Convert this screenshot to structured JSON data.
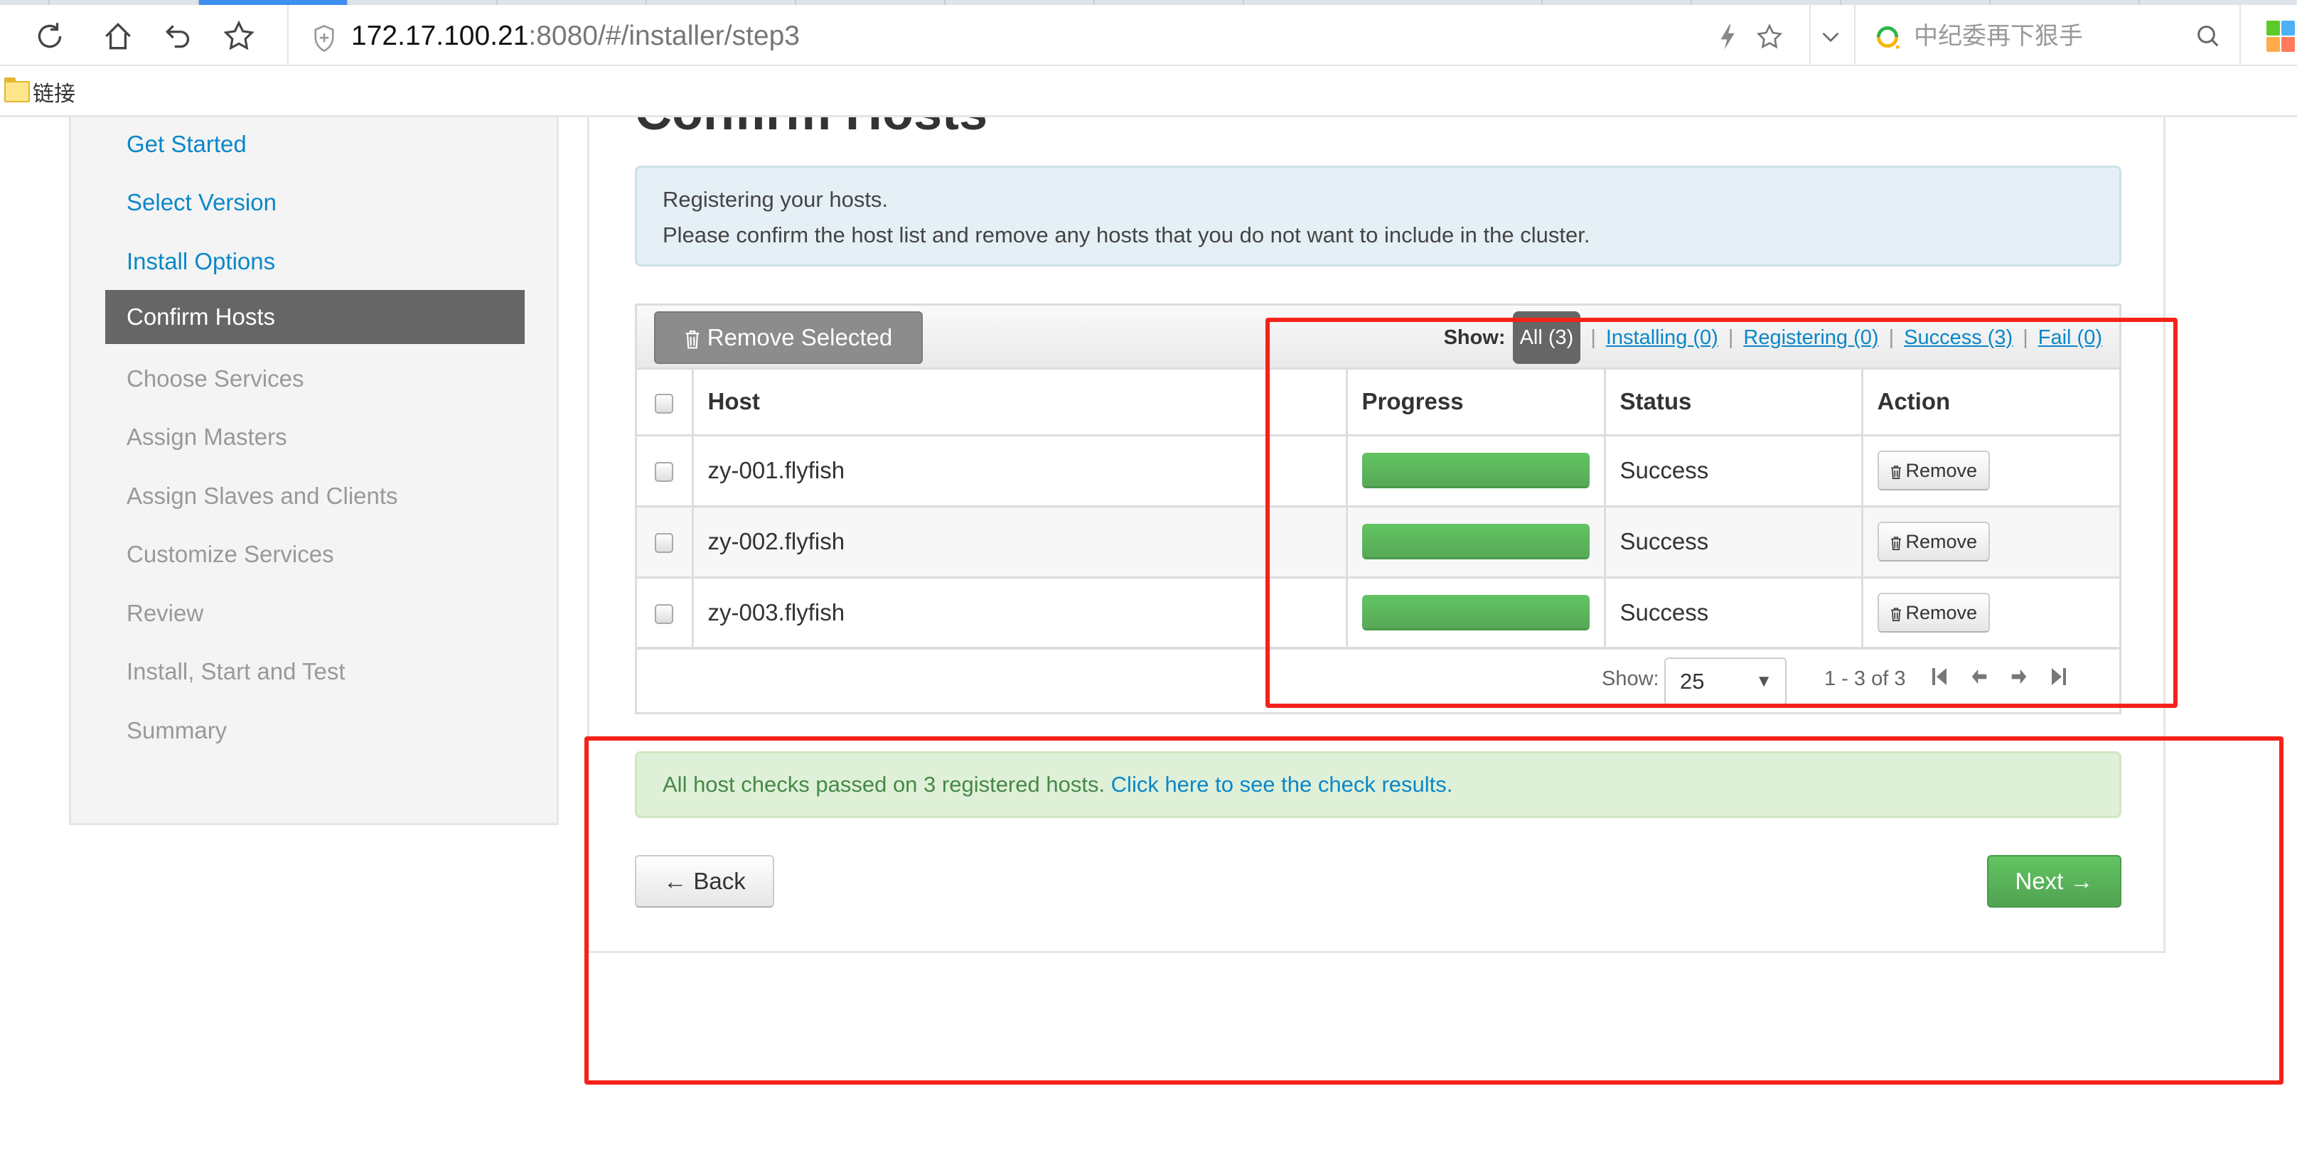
{
  "browser": {
    "address_host": "172.17.100.21",
    "address_rest": ":8080/#/installer/step3",
    "search_placeholder": "中纪委再下狠手",
    "bookmark_folder": "链接",
    "icons": [
      "reload-icon",
      "home-icon",
      "undo-icon",
      "favorite-star-icon",
      "shield-icon",
      "lightning-icon",
      "star-icon",
      "chevron-down-icon",
      "search-logo-icon",
      "search-icon",
      "apps-icon"
    ]
  },
  "sidebar": {
    "items": [
      {
        "label": "Get Started",
        "state": "done"
      },
      {
        "label": "Select Version",
        "state": "done"
      },
      {
        "label": "Install Options",
        "state": "done"
      },
      {
        "label": "Confirm Hosts",
        "state": "active"
      },
      {
        "label": "Choose Services",
        "state": "todo"
      },
      {
        "label": "Assign Masters",
        "state": "todo"
      },
      {
        "label": "Assign Slaves and Clients",
        "state": "todo"
      },
      {
        "label": "Customize Services",
        "state": "todo"
      },
      {
        "label": "Review",
        "state": "todo"
      },
      {
        "label": "Install, Start and Test",
        "state": "todo"
      },
      {
        "label": "Summary",
        "state": "todo"
      }
    ]
  },
  "main": {
    "title": "Confirm Hosts",
    "info_line1": "Registering your hosts.",
    "info_line2": "Please confirm the host list and remove any hosts that you do not want to include in the cluster.",
    "remove_selected_label": "Remove Selected",
    "filter": {
      "label": "Show:",
      "active": "All (3)",
      "links": [
        "Installing (0)",
        "Registering (0)",
        "Success (3)",
        "Fail (0)"
      ]
    },
    "table": {
      "headers": [
        "Host",
        "Progress",
        "Status",
        "Action"
      ],
      "rows": [
        {
          "host": "zy-001.flyfish",
          "progress_pct": 100,
          "status": "Success",
          "action": "Remove"
        },
        {
          "host": "zy-002.flyfish",
          "progress_pct": 100,
          "status": "Success",
          "action": "Remove"
        },
        {
          "host": "zy-003.flyfish",
          "progress_pct": 100,
          "status": "Success",
          "action": "Remove"
        }
      ]
    },
    "pager": {
      "show_label": "Show:",
      "page_size": "25",
      "range_info": "1 - 3 of 3"
    },
    "success_text": "All host checks passed on 3 registered hosts. ",
    "success_link": "Click here to see the check results.",
    "back_label": "← Back",
    "next_label": "Next →"
  },
  "colors": {
    "accent_link": "#0a87c9",
    "success_green": "#468847",
    "annotation_red": "#f4221a"
  }
}
